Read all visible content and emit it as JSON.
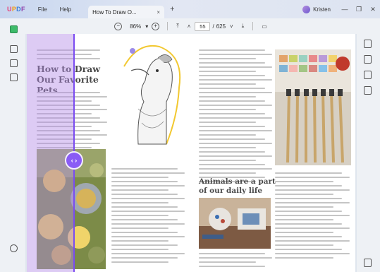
{
  "app": {
    "logo": "UPDF"
  },
  "menu": {
    "file": "File",
    "help": "Help"
  },
  "tab": {
    "title": "How To Draw O...",
    "close": "×",
    "add": "+"
  },
  "user": {
    "name": "Kristen"
  },
  "window": {
    "minimize": "—",
    "restore": "❐",
    "close": "✕"
  },
  "toolbar": {
    "zoom_out": "−",
    "zoom": "86%",
    "zoom_dropdown": "▾",
    "zoom_in": "+",
    "first_page": "⤒",
    "prev_page": "˄",
    "page_current": "55",
    "page_separator": "/",
    "page_total": "625",
    "next_page": "˅",
    "last_page": "⤓",
    "presentation": "▭"
  },
  "document": {
    "heading_left": "How to Draw Our Favorite Pets",
    "heading_right": "Animals are a part of our daily life"
  },
  "compare": {
    "handle": "‹ ›"
  },
  "colors": {
    "accent": "#7a4cf0",
    "overlay": "#b48ce6"
  }
}
